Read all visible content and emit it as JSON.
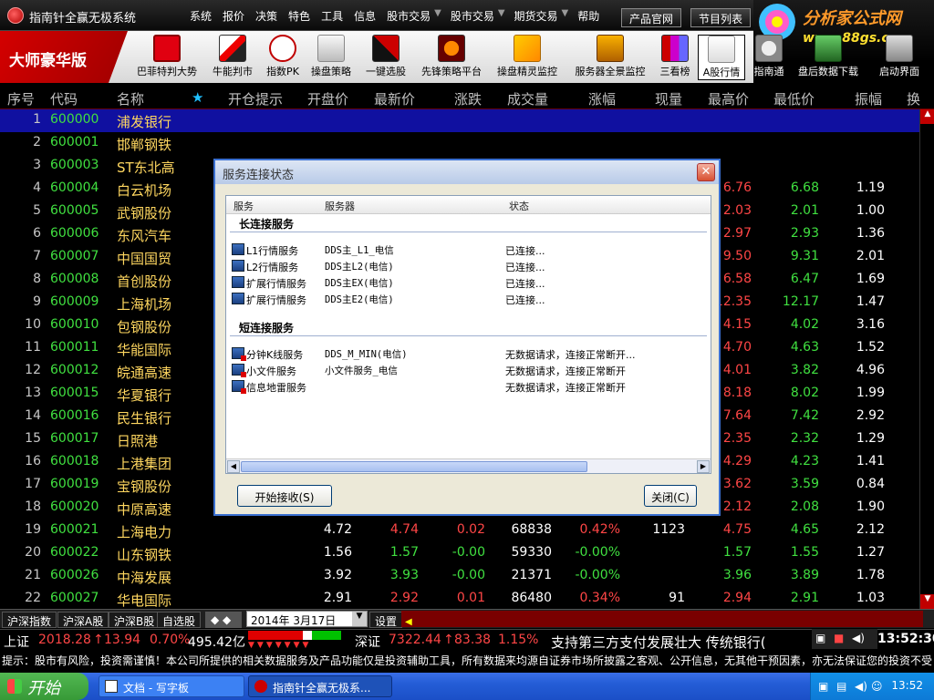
{
  "app": {
    "title": "指南针全赢无极系统"
  },
  "menu": [
    "系统",
    "报价",
    "决策",
    "特色",
    "工具",
    "信息",
    "股市交易",
    "股市交易",
    "期货交易",
    "帮助"
  ],
  "top_buttons": {
    "site": "产品官网",
    "programs": "节目列表"
  },
  "logo": {
    "text": "分析家公式网",
    "url": "www.88gs.com"
  },
  "brand": "大师豪华版",
  "tools": [
    {
      "label": "巴菲特判大势",
      "icon": "buffett-icon"
    },
    {
      "label": "牛能判市",
      "icon": "bull-power-icon"
    },
    {
      "label": "指数PK",
      "icon": "pk-icon"
    },
    {
      "label": "操盘策略",
      "icon": "strategy-icon"
    },
    {
      "label": "一键选股",
      "icon": "one-click-icon"
    },
    {
      "label": "先锋策略平台",
      "icon": "pioneer-icon"
    },
    {
      "label": "操盘精灵监控",
      "icon": "genie-monitor-icon"
    },
    {
      "label": "服务器全景监控",
      "icon": "server-monitor-icon"
    },
    {
      "label": "三看榜",
      "icon": "three-list-icon"
    },
    {
      "label": "A股行情",
      "icon": "a-share-icon"
    },
    {
      "label": "指南通",
      "icon": "guide-icon"
    },
    {
      "label": "盘后数据下载",
      "icon": "download-icon"
    },
    {
      "label": "启动界面",
      "icon": "startup-icon"
    }
  ],
  "columns": [
    "序号",
    "代码",
    "名称",
    "★",
    "开仓提示",
    "开盘价",
    "最新价",
    "涨跌",
    "成交量",
    "涨幅",
    "现量",
    "最高价",
    "最低价",
    "振幅",
    "换"
  ],
  "rows": [
    {
      "no": "1",
      "code": "600000",
      "name": "浦发银行",
      "open": "",
      "last": "",
      "chg": "",
      "vol": "",
      "pct": "",
      "cur": "",
      "high": "",
      "low": "",
      "amp": ""
    },
    {
      "no": "2",
      "code": "600001",
      "name": "邯郸钢铁",
      "open": "",
      "last": "",
      "chg": "",
      "vol": "",
      "pct": "",
      "cur": "",
      "high": "",
      "low": "",
      "amp": ""
    },
    {
      "no": "3",
      "code": "600003",
      "name": "ST东北高",
      "open": "",
      "last": "",
      "chg": "",
      "vol": "",
      "pct": "",
      "cur": "",
      "high": "",
      "low": "",
      "amp": ""
    },
    {
      "no": "4",
      "code": "600004",
      "name": "白云机场",
      "open": "",
      "last": "",
      "chg": "",
      "vol": "",
      "pct": "",
      "cur": "",
      "high": "6.76",
      "low": "6.68",
      "amp": "1.19"
    },
    {
      "no": "5",
      "code": "600005",
      "name": "武钢股份",
      "open": "",
      "last": "",
      "chg": "",
      "vol": "",
      "pct": "",
      "cur": "",
      "high": "2.03",
      "low": "2.01",
      "amp": "1.00"
    },
    {
      "no": "6",
      "code": "600006",
      "name": "东风汽车",
      "open": "",
      "last": "",
      "chg": "",
      "vol": "",
      "pct": "",
      "cur": "",
      "high": "2.97",
      "low": "2.93",
      "amp": "1.36"
    },
    {
      "no": "7",
      "code": "600007",
      "name": "中国国贸",
      "open": "",
      "last": "",
      "chg": "",
      "vol": "",
      "pct": "",
      "cur": "",
      "high": "9.50",
      "low": "9.31",
      "amp": "2.01"
    },
    {
      "no": "8",
      "code": "600008",
      "name": "首创股份",
      "open": "",
      "last": "",
      "chg": "",
      "vol": "",
      "pct": "",
      "cur": "",
      "high": "6.58",
      "low": "6.47",
      "amp": "1.69"
    },
    {
      "no": "9",
      "code": "600009",
      "name": "上海机场",
      "open": "",
      "last": "",
      "chg": "",
      "vol": "",
      "pct": "",
      "cur": "",
      "high": "12.35",
      "low": "12.17",
      "amp": "1.47"
    },
    {
      "no": "10",
      "code": "600010",
      "name": "包钢股份",
      "open": "",
      "last": "",
      "chg": "",
      "vol": "",
      "pct": "",
      "cur": "",
      "high": "4.15",
      "low": "4.02",
      "amp": "3.16"
    },
    {
      "no": "11",
      "code": "600011",
      "name": "华能国际",
      "open": "",
      "last": "",
      "chg": "",
      "vol": "",
      "pct": "",
      "cur": "",
      "high": "4.70",
      "low": "4.63",
      "amp": "1.52"
    },
    {
      "no": "12",
      "code": "600012",
      "name": "皖通高速",
      "open": "",
      "last": "",
      "chg": "",
      "vol": "",
      "pct": "",
      "cur": "",
      "high": "4.01",
      "low": "3.82",
      "amp": "4.96"
    },
    {
      "no": "13",
      "code": "600015",
      "name": "华夏银行",
      "open": "",
      "last": "",
      "chg": "",
      "vol": "",
      "pct": "",
      "cur": "",
      "high": "8.18",
      "low": "8.02",
      "amp": "1.99"
    },
    {
      "no": "14",
      "code": "600016",
      "name": "民生银行",
      "open": "",
      "last": "",
      "chg": "",
      "vol": "",
      "pct": "",
      "cur": "",
      "high": "7.64",
      "low": "7.42",
      "amp": "2.92"
    },
    {
      "no": "15",
      "code": "600017",
      "name": "日照港",
      "open": "",
      "last": "",
      "chg": "",
      "vol": "",
      "pct": "",
      "cur": "",
      "high": "2.35",
      "low": "2.32",
      "amp": "1.29"
    },
    {
      "no": "16",
      "code": "600018",
      "name": "上港集团",
      "open": "",
      "last": "",
      "chg": "",
      "vol": "",
      "pct": "",
      "cur": "",
      "high": "4.29",
      "low": "4.23",
      "amp": "1.41"
    },
    {
      "no": "17",
      "code": "600019",
      "name": "宝钢股份",
      "open": "",
      "last": "",
      "chg": "",
      "vol": "",
      "pct": "",
      "cur": "",
      "high": "3.62",
      "low": "3.59",
      "amp": "0.84"
    },
    {
      "no": "18",
      "code": "600020",
      "name": "中原高速",
      "open": "",
      "last": "",
      "chg": "",
      "vol": "",
      "pct": "",
      "cur": "",
      "high": "2.12",
      "low": "2.08",
      "amp": "1.90"
    },
    {
      "no": "19",
      "code": "600021",
      "name": "上海电力",
      "open": "4.72",
      "last": "4.74",
      "chg": "0.02",
      "vol": "68838",
      "pct": "0.42%",
      "cur": "1123",
      "high": "4.75",
      "low": "4.65",
      "amp": "2.12"
    },
    {
      "no": "20",
      "code": "600022",
      "name": "山东钢铁",
      "open": "1.56",
      "last": "1.57",
      "chg": "-0.00",
      "vol": "59330",
      "pct": "-0.00%",
      "cur": "",
      "high": "1.57",
      "low": "1.55",
      "amp": "1.27"
    },
    {
      "no": "21",
      "code": "600026",
      "name": "中海发展",
      "open": "3.92",
      "last": "3.93",
      "chg": "-0.00",
      "vol": "21371",
      "pct": "-0.00%",
      "cur": "",
      "high": "3.96",
      "low": "3.89",
      "amp": "1.78"
    },
    {
      "no": "22",
      "code": "600027",
      "name": "华电国际",
      "open": "2.91",
      "last": "2.92",
      "chg": "0.01",
      "vol": "86480",
      "pct": "0.34%",
      "cur": "91",
      "high": "2.94",
      "low": "2.91",
      "amp": "1.03"
    }
  ],
  "colors": {
    "up": "#ff4646",
    "down": "#40e040",
    "flat": "#ffffff",
    "selected_row": "#1010a0"
  },
  "bottom_tabs": [
    "沪深指数",
    "沪深A股",
    "沪深B股",
    "自选股"
  ],
  "date_select": "2014年 3月17日",
  "settings_label": "设置",
  "ticker": {
    "sh_label": "上证",
    "sh_value": "2018.28",
    "sh_chg": "13.94",
    "sh_pct": "0.70%",
    "sh_amount": "495.42亿",
    "sz_label": "深证",
    "sz_value": "7322.44",
    "sz_chg": "83.38",
    "sz_pct": "1.15%",
    "scroll_text": "支持第三方支付发展壮大  传统银行(",
    "time": "13:52:30"
  },
  "notice": "提示：股市有风险，投资需谨慎！本公司所提供的相关数据服务及产品功能仅是投资辅助工具，所有数据来均源自证券市场所披露之客观、公开信息，无其他干预因素，亦无法保证您的投资不受",
  "taskbar": {
    "start": "开始",
    "items": [
      {
        "label": "文档 - 写字板"
      },
      {
        "label": "指南针全赢无极系..."
      }
    ],
    "time": "13:52"
  },
  "dialog": {
    "title": "服务连接状态",
    "headers": [
      "服务",
      "服务器",
      "状态"
    ],
    "groups": [
      {
        "name": "长连接服务",
        "items": [
          {
            "service": "L1行情服务",
            "server": "DDS主_L1_电信",
            "status": "已连接..."
          },
          {
            "service": "L2行情服务",
            "server": "DDS主L2(电信)",
            "status": "已连接..."
          },
          {
            "service": "扩展行情服务",
            "server": "DDS主EX(电信)",
            "status": "已连接..."
          },
          {
            "service": "扩展行情服务",
            "server": "DDS主E2(电信)",
            "status": "已连接..."
          }
        ]
      },
      {
        "name": "短连接服务",
        "items": [
          {
            "service": "分钟K线服务",
            "server": "DDS_M_MIN(电信)",
            "status": "无数据请求，连接正常断开..."
          },
          {
            "service": "小文件服务",
            "server": "小文件服务_电信",
            "status": "无数据请求，连接正常断开"
          },
          {
            "service": "信息地雷服务",
            "server": "",
            "status": "无数据请求，连接正常断开"
          }
        ]
      }
    ],
    "start_button": "开始接收(S)",
    "close_button": "关闭(C)"
  }
}
